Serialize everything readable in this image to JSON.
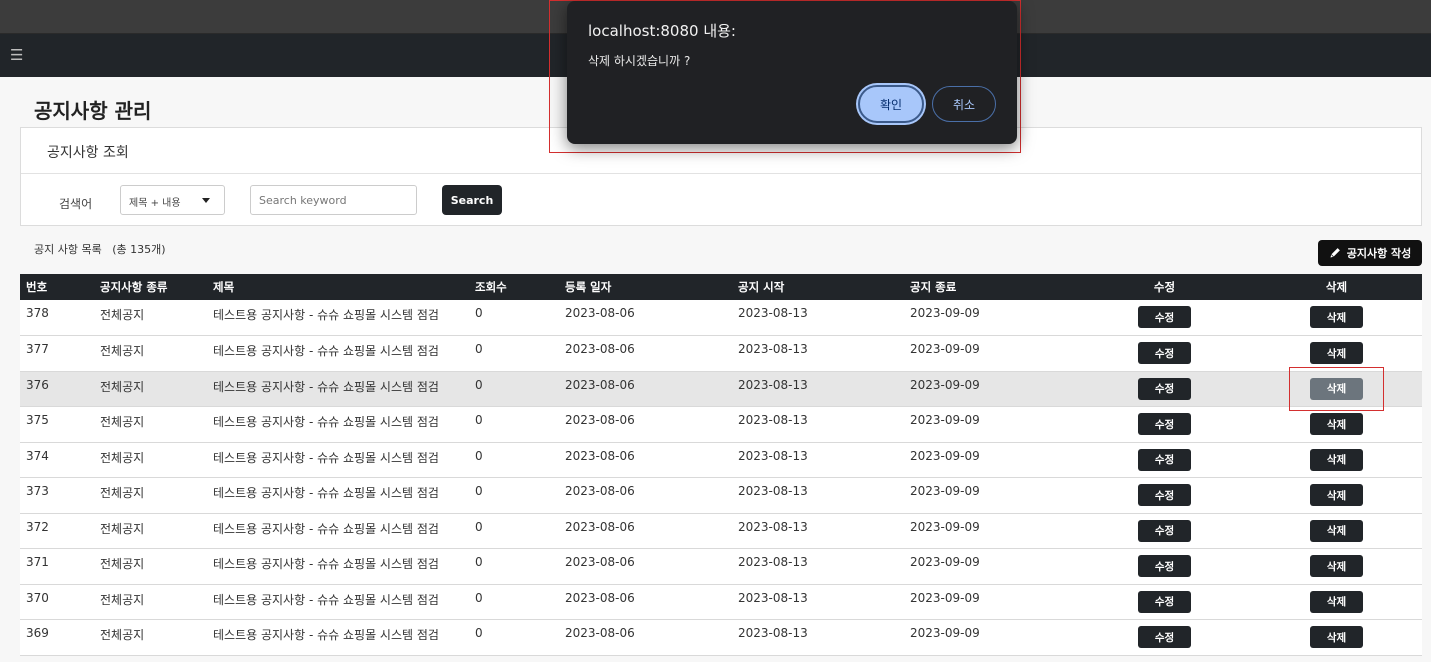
{
  "navbar": {
    "menu_icon": "hamburger-icon"
  },
  "page": {
    "title": "공지사항 관리"
  },
  "search": {
    "section_title": "공지사항 조회",
    "label": "검색어",
    "select_value": "제목 + 내용",
    "placeholder": "Search keyword",
    "button_label": "Search"
  },
  "list": {
    "summary": "공지 사항 목록   (총 135개)",
    "write_button": "공지사항 작성",
    "write_icon": "pen-icon"
  },
  "table": {
    "headers": [
      "번호",
      "공지사항 종류",
      "제목",
      "조회수",
      "등록 일자",
      "공지 시작",
      "공지 종료",
      "수정",
      "삭제"
    ],
    "edit_label": "수정",
    "delete_label": "삭제",
    "rows": [
      {
        "no": "378",
        "type": "전체공지",
        "title": "테스트용 공지사항 - 슈슈 쇼핑몰 시스템 점검",
        "views": "0",
        "created": "2023-08-06",
        "start": "2023-08-13",
        "end": "2023-09-09"
      },
      {
        "no": "377",
        "type": "전체공지",
        "title": "테스트용 공지사항 - 슈슈 쇼핑몰 시스템 점검",
        "views": "0",
        "created": "2023-08-06",
        "start": "2023-08-13",
        "end": "2023-09-09"
      },
      {
        "no": "376",
        "type": "전체공지",
        "title": "테스트용 공지사항 - 슈슈 쇼핑몰 시스템 점검",
        "views": "0",
        "created": "2023-08-06",
        "start": "2023-08-13",
        "end": "2023-09-09"
      },
      {
        "no": "375",
        "type": "전체공지",
        "title": "테스트용 공지사항 - 슈슈 쇼핑몰 시스템 점검",
        "views": "0",
        "created": "2023-08-06",
        "start": "2023-08-13",
        "end": "2023-09-09"
      },
      {
        "no": "374",
        "type": "전체공지",
        "title": "테스트용 공지사항 - 슈슈 쇼핑몰 시스템 점검",
        "views": "0",
        "created": "2023-08-06",
        "start": "2023-08-13",
        "end": "2023-09-09"
      },
      {
        "no": "373",
        "type": "전체공지",
        "title": "테스트용 공지사항 - 슈슈 쇼핑몰 시스템 점검",
        "views": "0",
        "created": "2023-08-06",
        "start": "2023-08-13",
        "end": "2023-09-09"
      },
      {
        "no": "372",
        "type": "전체공지",
        "title": "테스트용 공지사항 - 슈슈 쇼핑몰 시스템 점검",
        "views": "0",
        "created": "2023-08-06",
        "start": "2023-08-13",
        "end": "2023-09-09"
      },
      {
        "no": "371",
        "type": "전체공지",
        "title": "테스트용 공지사항 - 슈슈 쇼핑몰 시스템 점검",
        "views": "0",
        "created": "2023-08-06",
        "start": "2023-08-13",
        "end": "2023-09-09"
      },
      {
        "no": "370",
        "type": "전체공지",
        "title": "테스트용 공지사항 - 슈슈 쇼핑몰 시스템 점검",
        "views": "0",
        "created": "2023-08-06",
        "start": "2023-08-13",
        "end": "2023-09-09"
      },
      {
        "no": "369",
        "type": "전체공지",
        "title": "테스트용 공지사항 - 슈슈 쇼핑몰 시스템 점검",
        "views": "0",
        "created": "2023-08-06",
        "start": "2023-08-13",
        "end": "2023-09-09"
      }
    ]
  },
  "dialog": {
    "title": "localhost:8080 내용:",
    "message": "삭제 하시겠습니까 ?",
    "confirm_label": "확인",
    "cancel_label": "취소"
  },
  "colors": {
    "navbar": "#212529",
    "dialog_bg": "#202124",
    "confirm_bg": "#a8c7fa",
    "highlight_border": "#d32f2f"
  }
}
